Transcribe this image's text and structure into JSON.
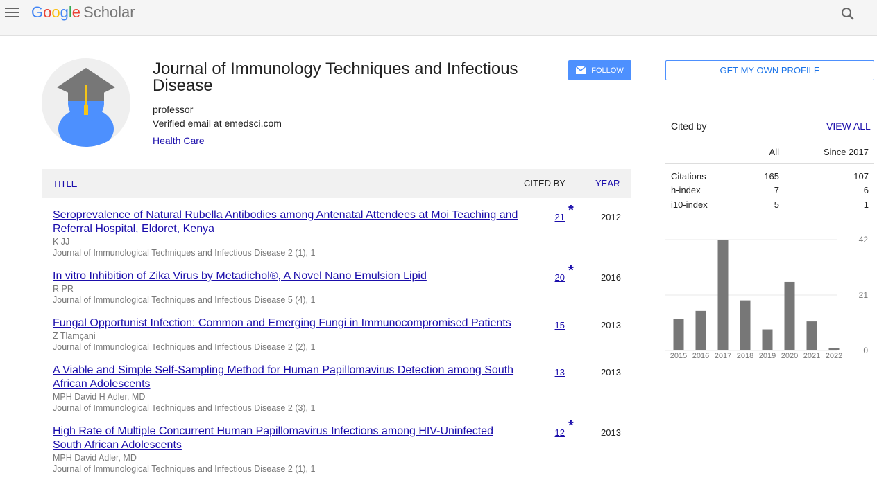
{
  "header": {
    "logo_google": [
      "G",
      "o",
      "o",
      "g",
      "l",
      "e"
    ],
    "logo_scholar": "Scholar"
  },
  "profile": {
    "name": "Journal of Immunology Techniques and Infectious Disease",
    "affiliation": "professor",
    "email": "Verified email at emedsci.com",
    "interest": "Health Care",
    "follow_label": "FOLLOW"
  },
  "table": {
    "col_title": "TITLE",
    "col_cited_by": "CITED BY",
    "col_year": "YEAR",
    "rows": [
      {
        "title": "Seroprevalence of Natural Rubella Antibodies among Antenatal Attendees at Moi Teaching and Referral Hospital, Eldoret, Kenya",
        "authors": "K JJ",
        "venue": "Journal of Immunological Techniques and Infectious Disease 2 (1), 1",
        "cited": "21",
        "star": "*",
        "year": "2012"
      },
      {
        "title": "In vitro Inhibition of Zika Virus by Metadichol®, A Novel Nano Emulsion Lipid",
        "authors": "R PR",
        "venue": "Journal of Immunological Techniques and Infectious Disease 5 (4), 1",
        "cited": "20",
        "star": "*",
        "year": "2016"
      },
      {
        "title": "Fungal Opportunist Infection: Common and Emerging Fungi in Immunocompromised Patients",
        "authors": "Z Tlamçani",
        "venue": "Journal of Immunological Techniques and Infectious Disease 2 (2), 1",
        "cited": "15",
        "star": "",
        "year": "2013"
      },
      {
        "title": "A Viable and Simple Self-Sampling Method for Human Papillomavirus Detection among South African Adolescents",
        "authors": "MPH David H Adler, MD",
        "venue": "Journal of Immunological Techniques and Infectious Disease 2 (3), 1",
        "cited": "13",
        "star": "",
        "year": "2013"
      },
      {
        "title": "High Rate of Multiple Concurrent Human Papillomavirus Infections among HIV-Uninfected South African Adolescents",
        "authors": "MPH David Adler, MD",
        "venue": "Journal of Immunological Techniques and Infectious Disease 2 (1), 1",
        "cited": "12",
        "star": "*",
        "year": "2013"
      }
    ]
  },
  "sidebar": {
    "own_profile_label": "GET MY OWN PROFILE",
    "cited_by_label": "Cited by",
    "view_all_label": "VIEW ALL",
    "col_all": "All",
    "col_since": "Since 2017",
    "stats": [
      {
        "label": "Citations",
        "all": "165",
        "since": "107"
      },
      {
        "label": "h-index",
        "all": "7",
        "since": "6"
      },
      {
        "label": "i10-index",
        "all": "5",
        "since": "1"
      }
    ]
  },
  "chart_data": {
    "type": "bar",
    "categories": [
      "2015",
      "2016",
      "2017",
      "2018",
      "2019",
      "2020",
      "2021",
      "2022"
    ],
    "values": [
      12,
      15,
      42,
      19,
      8,
      26,
      11,
      1
    ],
    "ylim": [
      0,
      42
    ],
    "yticks": [
      "0",
      "21",
      "42"
    ],
    "bar_color": "#777777"
  }
}
